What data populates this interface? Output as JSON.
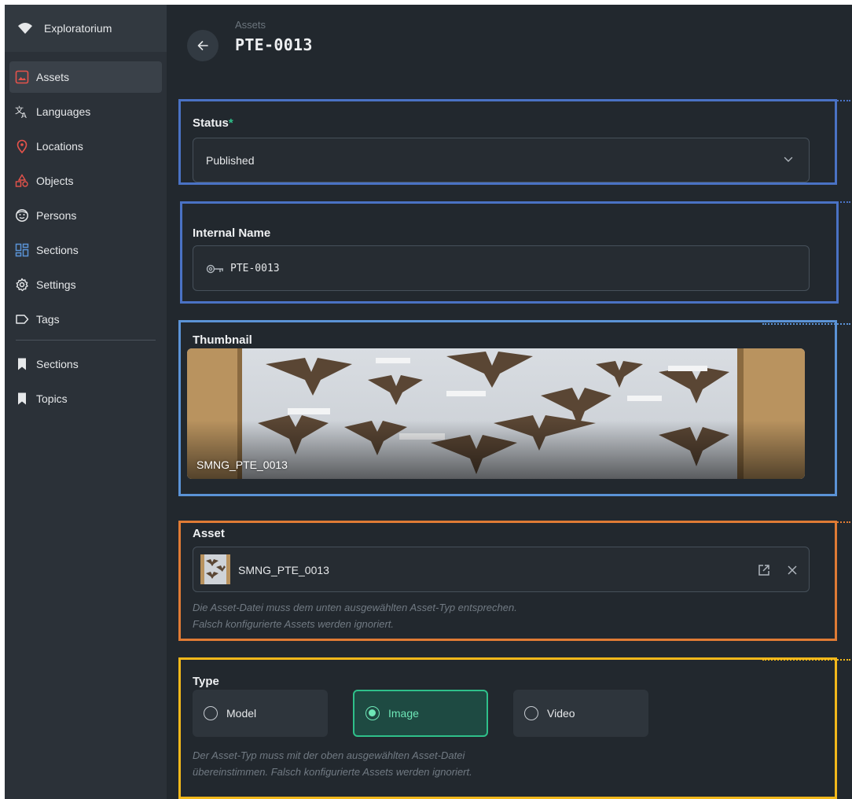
{
  "app": {
    "name": "Exploratorium"
  },
  "sidebar": {
    "items": [
      {
        "label": "Assets",
        "icon": "image-icon",
        "active": true
      },
      {
        "label": "Languages",
        "icon": "translate-icon"
      },
      {
        "label": "Locations",
        "icon": "map-pin-icon"
      },
      {
        "label": "Objects",
        "icon": "shapes-icon"
      },
      {
        "label": "Persons",
        "icon": "face-icon"
      },
      {
        "label": "Sections",
        "icon": "layout-icon"
      },
      {
        "label": "Settings",
        "icon": "gear-icon"
      },
      {
        "label": "Tags",
        "icon": "tag-icon"
      }
    ],
    "secondary": [
      {
        "label": "Sections",
        "icon": "bookmark-icon"
      },
      {
        "label": "Topics",
        "icon": "bookmark-icon"
      }
    ]
  },
  "header": {
    "breadcrumb": "Assets",
    "title": "PTE-0013"
  },
  "form": {
    "status": {
      "label": "Status",
      "required": "*",
      "value": "Published"
    },
    "internal_name": {
      "label": "Internal Name",
      "value": "PTE-0013"
    },
    "thumbnail": {
      "label": "Thumbnail",
      "caption": "SMNG_PTE_0013"
    },
    "asset": {
      "label": "Asset",
      "file_name": "SMNG_PTE_0013",
      "hint_line1": "Die Asset-Datei muss dem unten ausgewählten Asset-Typ entsprechen.",
      "hint_line2": "Falsch konfigurierte Assets werden ignoriert."
    },
    "type": {
      "label": "Type",
      "options": [
        "Model",
        "Image",
        "Video"
      ],
      "selected": "Image",
      "hint_line1": "Der Asset-Typ muss mit der oben ausgewählten Asset-Datei",
      "hint_line2": "übereinstimmen. Falsch konfigurierte Assets werden ignoriert."
    }
  },
  "colors": {
    "annotation_blue": "#4a72c4",
    "annotation_lightblue": "#5b93d6",
    "annotation_orange": "#e07b35",
    "annotation_yellow": "#f2b81b",
    "accent_green": "#2fc08a",
    "danger_red": "#e5534b"
  }
}
